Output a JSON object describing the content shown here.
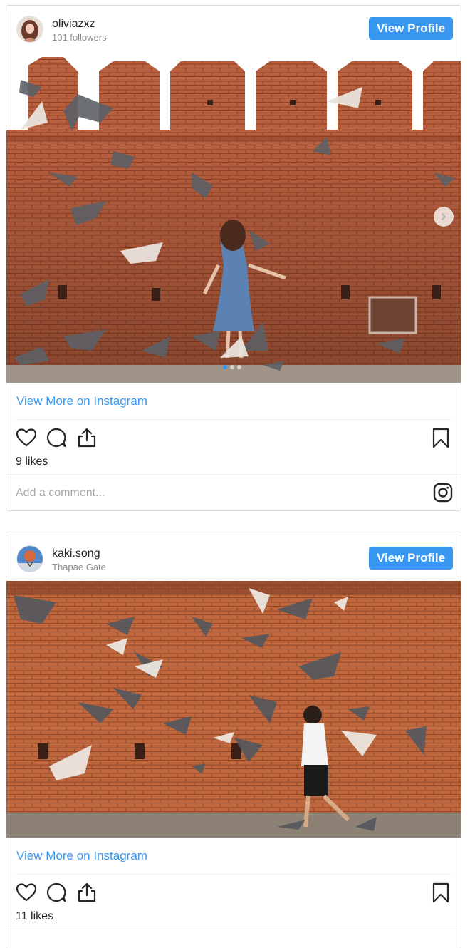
{
  "posts": [
    {
      "username": "oliviazxz",
      "subtitle": "101 followers",
      "profile_button": "View Profile",
      "view_more": "View More on Instagram",
      "likes": "9 likes",
      "comment_placeholder": "Add a comment...",
      "carousel": {
        "slides": 3,
        "current": 1
      }
    },
    {
      "username": "kaki.song",
      "subtitle": "Thapae Gate",
      "profile_button": "View Profile",
      "view_more": "View More on Instagram",
      "likes": "11 likes"
    }
  ],
  "icons": [
    "heart-icon",
    "comment-icon",
    "share-icon",
    "bookmark-icon",
    "instagram-icon",
    "chevron-right-icon"
  ],
  "colors": {
    "accent": "#3897f0",
    "brick": "#b5593a",
    "text": "#262626",
    "muted": "#8e8e8e"
  }
}
